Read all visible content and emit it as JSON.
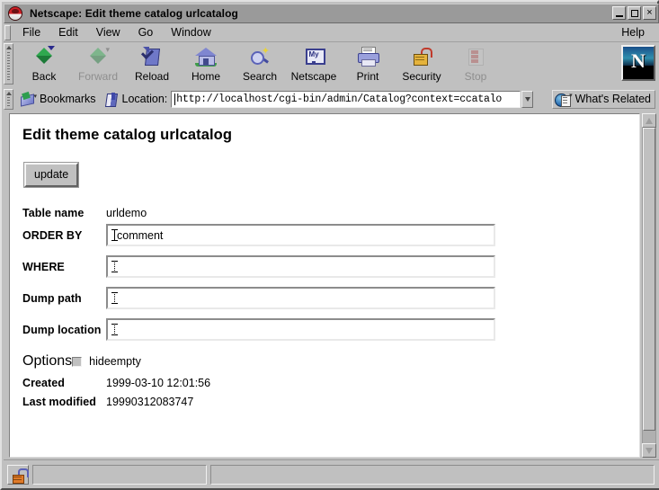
{
  "window": {
    "title": "Netscape: Edit theme catalog urlcatalog",
    "app_icon": "netscape-ship-wheel-icon",
    "controls": {
      "minimize": "_",
      "maximize": "□",
      "close": "×"
    }
  },
  "menubar": {
    "items": [
      {
        "label": "File"
      },
      {
        "label": "Edit"
      },
      {
        "label": "View"
      },
      {
        "label": "Go"
      },
      {
        "label": "Window"
      }
    ],
    "help": "Help"
  },
  "toolbar": {
    "buttons": [
      {
        "label": "Back",
        "icon": "back-arrow-icon",
        "enabled": true
      },
      {
        "label": "Forward",
        "icon": "forward-arrow-icon",
        "enabled": false
      },
      {
        "label": "Reload",
        "icon": "reload-page-icon",
        "enabled": true
      },
      {
        "label": "Home",
        "icon": "home-house-icon",
        "enabled": true
      },
      {
        "label": "Search",
        "icon": "search-flashlight-icon",
        "enabled": true
      },
      {
        "label": "Netscape",
        "icon": "my-netscape-icon",
        "enabled": true
      },
      {
        "label": "Print",
        "icon": "printer-icon",
        "enabled": true
      },
      {
        "label": "Security",
        "icon": "security-padlock-icon",
        "enabled": true
      },
      {
        "label": "Stop",
        "icon": "stop-sign-icon",
        "enabled": false
      }
    ],
    "logo_letter": "N"
  },
  "locationbar": {
    "bookmarks_label": "Bookmarks",
    "location_label": "Location:",
    "url": "http://localhost/cgi-bin/admin/Catalog?context=ccatalo",
    "whats_related_label": "What's Related"
  },
  "page": {
    "heading": "Edit theme catalog urlcatalog",
    "update_button": "update",
    "fields": [
      {
        "label": "Table name",
        "type": "text",
        "value": "urldemo"
      },
      {
        "label": "ORDER BY",
        "type": "input",
        "value": "comment"
      },
      {
        "label": "WHERE",
        "type": "input",
        "value": ""
      },
      {
        "label": "Dump path",
        "type": "input",
        "value": ""
      },
      {
        "label": "Dump location",
        "type": "input",
        "value": ""
      }
    ],
    "options": {
      "label": "Options",
      "checkbox_label": "hideempty",
      "checked": false
    },
    "meta": [
      {
        "label": "Created",
        "value": "1999-03-10 12:01:56"
      },
      {
        "label": "Last modified",
        "value": "19990312083747"
      }
    ]
  },
  "statusbar": {
    "security_icon": "unlocked-padlock-icon",
    "message": "",
    "progress": ""
  },
  "scrollbar": {
    "up_arrow": "scroll-up-icon",
    "down_arrow": "scroll-down-icon"
  }
}
